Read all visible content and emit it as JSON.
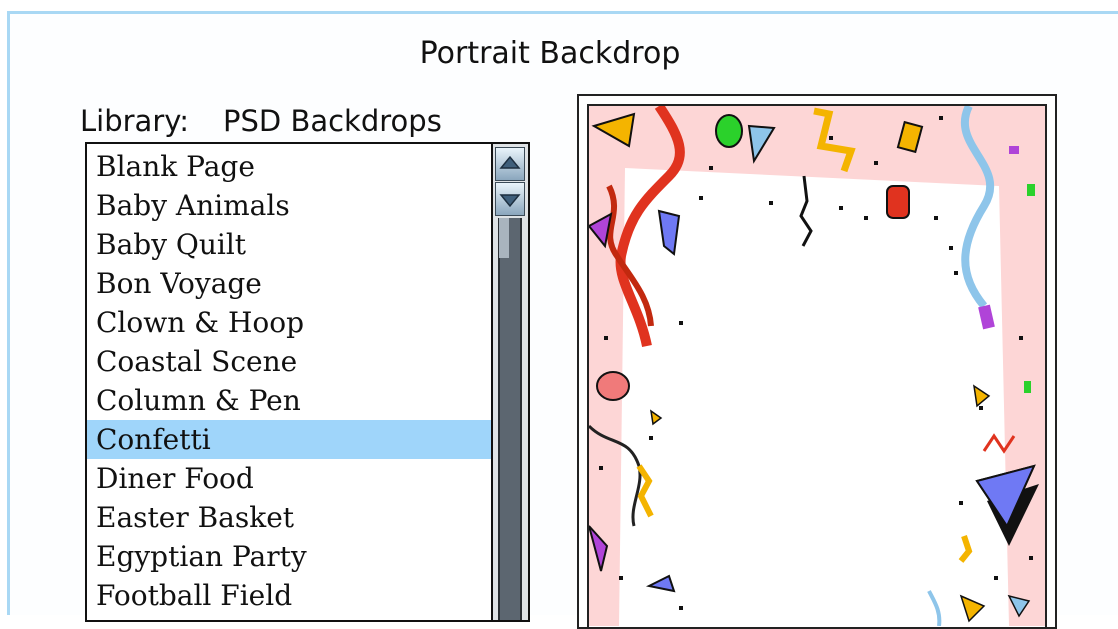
{
  "dialog": {
    "title": "Portrait Backdrop",
    "library_label": "Library:",
    "library_value": "PSD Backdrops"
  },
  "backdrop_list": {
    "selected": "Confetti",
    "items": [
      "Blank Page",
      "Baby Animals",
      "Baby Quilt",
      "Bon Voyage",
      "Clown & Hoop",
      "Coastal Scene",
      "Column & Pen",
      "Confetti",
      "Diner Food",
      "Easter Basket",
      "Egyptian Party",
      "Football Field"
    ]
  },
  "icons": {
    "scroll_up": "scroll-up-arrow-icon",
    "scroll_down": "scroll-down-arrow-icon"
  },
  "colors": {
    "window_border": "#a9d8f4",
    "selection": "#9fd5fa",
    "preview_pink": "#fdd6d6"
  }
}
